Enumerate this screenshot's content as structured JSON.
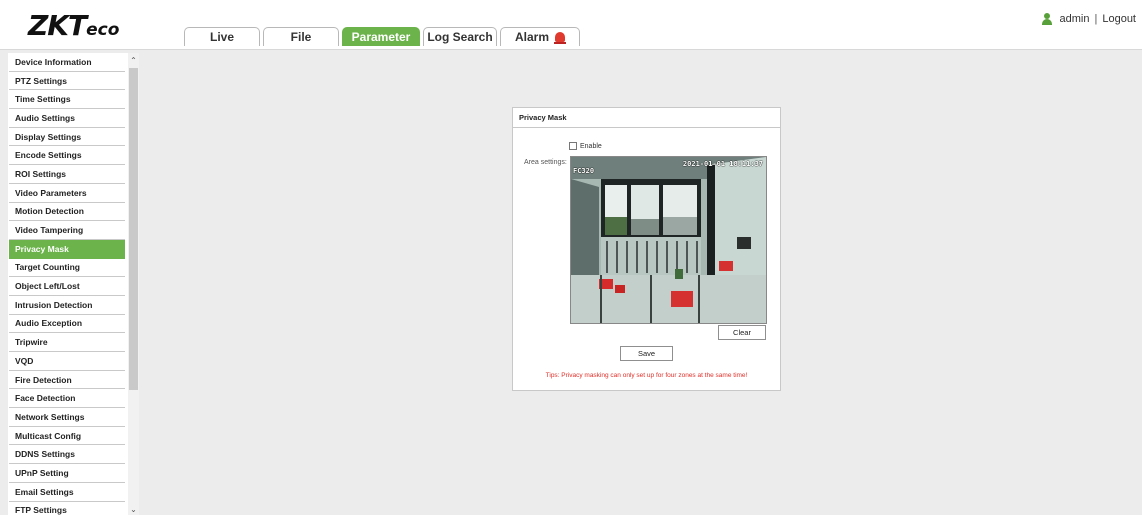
{
  "brand": {
    "logo_main": "ZKT",
    "logo_suffix": "eco"
  },
  "nav": {
    "tabs": [
      {
        "label": "Live",
        "active": false
      },
      {
        "label": "File",
        "active": false
      },
      {
        "label": "Parameter",
        "active": true
      },
      {
        "label": "Log Search",
        "active": false
      },
      {
        "label": "Alarm",
        "active": false
      }
    ],
    "alarm_icon": "alarm-bell-icon"
  },
  "user": {
    "name": "admin",
    "separator": "|",
    "logout": "Logout",
    "icon": "user-icon"
  },
  "sidebar": {
    "active_item": "Privacy Mask",
    "items": [
      "Device Information",
      "PTZ Settings",
      "Time Settings",
      "Audio Settings",
      "Display Settings",
      "Encode Settings",
      "ROI Settings",
      "Video Parameters",
      "Motion Detection",
      "Video Tampering",
      "Privacy Mask",
      "Target Counting",
      "Object Left/Lost",
      "Intrusion Detection",
      "Audio Exception",
      "Tripwire",
      "VQD",
      "Fire Detection",
      "Face Detection",
      "Network Settings",
      "Multicast Config",
      "DDNS Settings",
      "UPnP Setting",
      "Email Settings",
      "FTP Settings"
    ]
  },
  "panel": {
    "title": "Privacy Mask",
    "enable_label": "Enable",
    "enable_checked": false,
    "area_label": "Area settings:",
    "preview": {
      "osd_timestamp": "2021-01-01 18:11:37",
      "osd_camera": "FC320"
    },
    "clear_label": "Clear",
    "save_label": "Save",
    "tips": "Tips: Privacy masking can only set up for four zones at the same time!"
  },
  "colors": {
    "accent": "#6bb34a",
    "tips": "#e0302a",
    "background": "#ececec"
  }
}
